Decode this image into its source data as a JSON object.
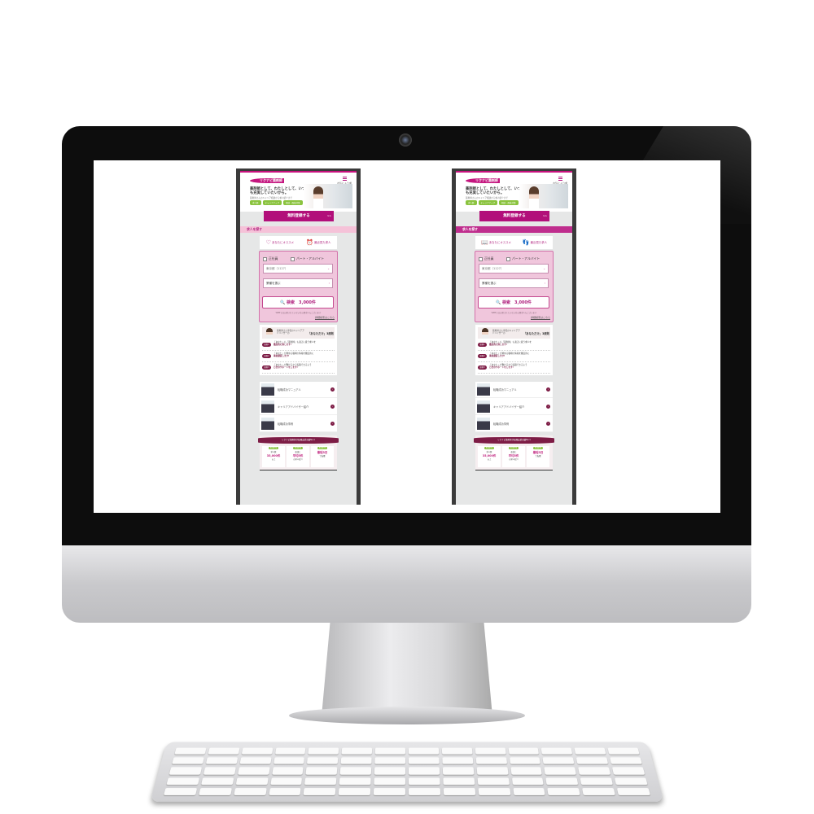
{
  "colors": {
    "brand": "#b20f7a",
    "accent_dark": "#7d1c45",
    "green": "#8ac33e"
  },
  "phone": {
    "logo": "リクナビ薬剤師",
    "menu_label": "お気に入り求人",
    "hero_title": "薬剤師として、わたしとして、いつも充実していたいから。",
    "hero_sub": "薬剤師さんのキャリア相談から求人紹介まで",
    "tags": [
      "求人数",
      "キャリアアップ",
      "相談・面接対策"
    ],
    "register": "無料登録する",
    "register_arrow": ">>",
    "section": "求人を探す",
    "tab_recommend": "あなたにオススメ",
    "tab_recent": "最近見た求人",
    "check_fulltime": "正社員",
    "check_parttime": "パート・アルバイト",
    "select_area": "東京都（1127）",
    "select_area_chevron": "⌄",
    "select_industry": "業種を選ぶ",
    "select_industry_chevron": "›",
    "search": "🔍 検索　3,000件",
    "note": "WEBでは公開されていない非公開求人もございます",
    "detail_link": "詳細検索はこちら",
    "advisor_intro": "薬剤師さん専任のキャリアアドバイザーの",
    "advisor_title": "「あなただけ」3原則",
    "principles": [
      {
        "badge": "原則1",
        "line1": "「あなた」も「薬剤師」も適正に扱う求人を",
        "line2": "徹底的に探します!"
      },
      {
        "badge": "原則2",
        "line1": "「あなた」が求める職場の情報を徹底的に",
        "line2": "事前調査します!"
      },
      {
        "badge": "原則3",
        "line1": "「あなた」が働けるから転職できるよう",
        "line2": "万全のサポートをします!"
      }
    ],
    "links": [
      "転職成功マニュアル",
      "キャリアアドバイザー紹介",
      "転職成功事例"
    ],
    "link_arrow": "›",
    "banner_title": "リクナビ薬剤師が転職支援実績No.1",
    "stats": [
      {
        "point": "POINT1",
        "label": "求人数",
        "value": "35,000件",
        "suffix": "以上"
      },
      {
        "point": "POINT2",
        "label": "面談に",
        "value": "平均5件",
        "suffix": "の求人紹介"
      },
      {
        "point": "POINT3",
        "label": "",
        "value": "最短3日",
        "suffix": "で転職"
      }
    ]
  },
  "phones": [
    {
      "section_bg": "#f5c2d8",
      "section_text": "#b0227f",
      "icon_recommend": "♡",
      "icon_recent": "⏰"
    },
    {
      "section_bg": "#bf2d8d",
      "section_text": "#ffffff",
      "icon_recommend": "📖",
      "icon_recent": "👣"
    }
  ]
}
